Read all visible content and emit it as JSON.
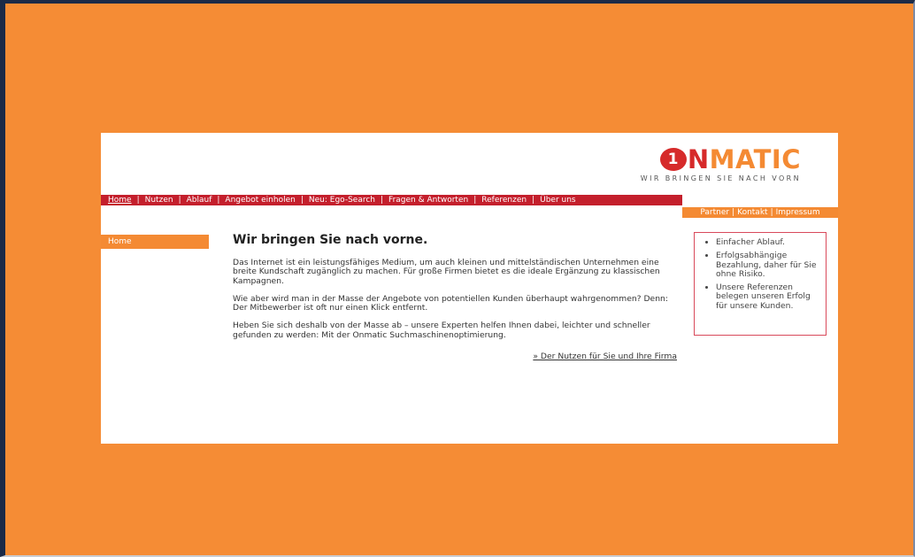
{
  "logo": {
    "mark": "1",
    "n": "N",
    "rest": "MATIC",
    "tagline": "WIR BRINGEN SIE NACH VORN"
  },
  "main_nav": [
    {
      "label": "Home",
      "active": true
    },
    {
      "label": "Nutzen"
    },
    {
      "label": "Ablauf"
    },
    {
      "label": "Angebot einholen"
    },
    {
      "label": "Neu: Ego-Search"
    },
    {
      "label": "Fragen & Antworten"
    },
    {
      "label": "Referenzen"
    },
    {
      "label": "Über uns"
    }
  ],
  "sub_nav": {
    "partner": "Partner",
    "kontakt": "Kontakt",
    "impressum": "Impressum",
    "separator": "|"
  },
  "side_nav": {
    "home": "Home"
  },
  "content": {
    "title": "Wir bringen Sie nach vorne.",
    "p1": "Das Internet ist ein leistungsfähiges Medium, um auch kleinen und mittelständischen Unternehmen eine breite Kundschaft zugänglich zu machen. Für große Firmen bietet es die ideale Ergänzung zu klassischen Kampagnen.",
    "p2": "Wie aber wird man in der Masse der Angebote von potentiellen Kunden überhaupt wahrgenommen? Denn: Der Mitbewerber ist oft nur einen Klick entfernt.",
    "p3": "Heben Sie sich deshalb von der Masse ab – unsere Experten helfen Ihnen dabei, leichter und schneller gefunden zu werden: Mit der Onmatic Suchmaschinenoptimierung.",
    "more_link": "» Der Nutzen für Sie und Ihre Firma"
  },
  "infobox": {
    "items": [
      "Einfacher Ablauf.",
      "Erfolgsabhängige Bezahlung, daher für Sie ohne Risiko.",
      "Unsere Referenzen belegen unseren Erfolg für unsere Kunden."
    ]
  },
  "colors": {
    "background_orange": "#f48a33",
    "nav_red": "#c41f2c",
    "logo_red": "#d62a2a",
    "box_border": "#d94a5b"
  }
}
